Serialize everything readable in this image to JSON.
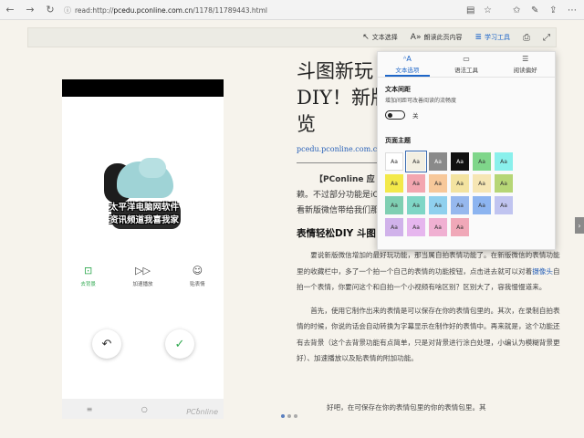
{
  "browser": {
    "url_prefix": "read:http://",
    "url_host": "pcedu.pconline.com.cn",
    "url_path": "/1178/11789443.html"
  },
  "reader_toolbar": {
    "text_select": "文本选择",
    "read_aloud": "朗读此页内容",
    "learning_tools": "学习工具"
  },
  "phone": {
    "sticker_line1": "太平洋电脑网软件",
    "sticker_line2": "资讯频道我喜我家",
    "tools": [
      {
        "label": "去背景",
        "glyph": "⊡"
      },
      {
        "label": "加速播放",
        "glyph": "▷▷"
      },
      {
        "label": "贴表情",
        "glyph": "☺"
      }
    ],
    "undo_glyph": "↶",
    "confirm_glyph": "✓",
    "nav": [
      "≡",
      "○",
      "‹"
    ],
    "watermark": "PConline"
  },
  "article": {
    "title": "斗图新玩法！微信表情DIY！新版功能抢先预览",
    "title_visible": "斗图新玩\nDIY！新版\n览",
    "source": "pcedu.pconline.com.cn",
    "lead_brand": "【PConline 应",
    "lead_rest": "赖。不过部分功能是iO",
    "lead_line2": "看新版微信带给我们那",
    "heading": "表情轻松DIY 斗图",
    "p1": "要说新版微信增加的最好玩功能，那当属自拍表情功能了。在新版微信的表情功能里的收藏栏中，多了一个拍一个自己的表情的功能按钮，点击进去就可以对着摄像头自拍一个表情，你要问这个和自拍一个小视频有啥区别？区别大了，容我慢慢道来。",
    "p1_link": "摄像头",
    "p2": "首先，使用它制作出来的表情是可以保存在你的表情包里的。其次，在录制自拍表情的时候，你说的话会自动转换为字幕显示在制作好的表情中。再来就是，这个功能还有去背景（这个去背景功能有点简单，只是对背景进行涂白处理，小编认为模糊背景更好）、加速播放以及贴表情的附加功能。",
    "tail": "好吧，在可保存在你的表情包里的你的表情包里。其"
  },
  "panel": {
    "tabs": [
      {
        "label": "文本选项",
        "glyph": "ᴬA",
        "active": true
      },
      {
        "label": "语法工具",
        "glyph": "▭",
        "active": false
      },
      {
        "label": "阅读偏好",
        "glyph": "☰",
        "active": false
      }
    ],
    "spacing_title": "文本间距",
    "spacing_desc": "增加间距可改善阅读的流畅度",
    "toggle_label": "关",
    "theme_title": "页面主题",
    "swatch_label": "Aa",
    "swatches": [
      "#ffffff",
      "#f3efe2",
      "#8a8a8a",
      "#111111",
      "#7fd68a",
      "#8af0ec",
      "#f3e94a",
      "#f3a6b0",
      "#f7c89a",
      "#f3e3a0",
      "#f6e6b4",
      "#b6d676",
      "#7fcfb2",
      "#7fd6c6",
      "#8fd0ee",
      "#96b8ee",
      "#8cb4f0",
      "#c0c4f0",
      "#d0b2ea",
      "#e6b6ee",
      "#f0b0d2",
      "#f0a8b8"
    ],
    "selected_index": 1,
    "dark_indexes": [
      2,
      3
    ]
  },
  "side_arrow": "›"
}
